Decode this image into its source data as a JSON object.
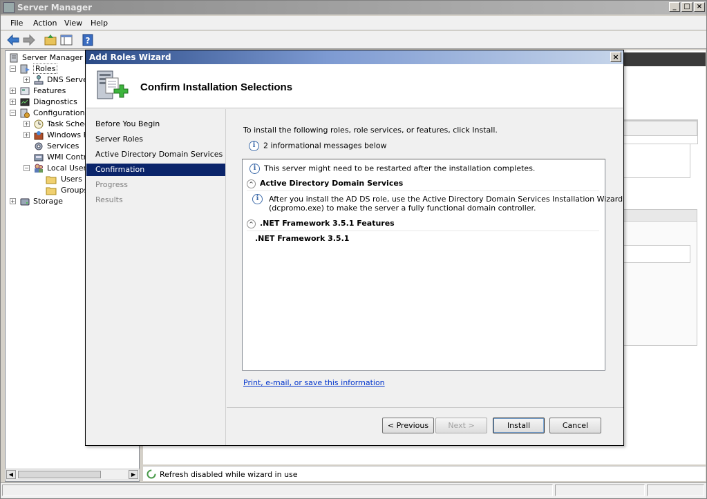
{
  "window": {
    "title": "Server Manager",
    "controls": {
      "minimize": "_",
      "maximize": "□",
      "close": "×"
    }
  },
  "menu": [
    "File",
    "Action",
    "View",
    "Help"
  ],
  "tree": {
    "root": "Server Manager (U",
    "items": [
      {
        "label": "Roles",
        "expand": "−"
      },
      {
        "label": "DNS Server",
        "expand": "+"
      },
      {
        "label": "Features",
        "expand": "+"
      },
      {
        "label": "Diagnostics",
        "expand": "+"
      },
      {
        "label": "Configuration",
        "expand": "−"
      },
      {
        "label": "Task Sched",
        "expand": "+"
      },
      {
        "label": "Windows Fi",
        "expand": "+"
      },
      {
        "label": "Services",
        "expand": ""
      },
      {
        "label": "WMI Contro",
        "expand": ""
      },
      {
        "label": "Local Users",
        "expand": "−"
      },
      {
        "label": "Users",
        "expand": ""
      },
      {
        "label": "Groups",
        "expand": ""
      },
      {
        "label": "Storage",
        "expand": "+"
      }
    ]
  },
  "status_strip": {
    "text": "Refresh disabled while wizard in use"
  },
  "dialog": {
    "title": "Add Roles Wizard",
    "close": "×",
    "heading": "Confirm Installation Selections",
    "steps": [
      {
        "label": "Before You Begin",
        "state": "normal"
      },
      {
        "label": "Server Roles",
        "state": "normal"
      },
      {
        "label": "Active Directory Domain Services",
        "state": "normal"
      },
      {
        "label": "Confirmation",
        "state": "active"
      },
      {
        "label": "Progress",
        "state": "disabled"
      },
      {
        "label": "Results",
        "state": "disabled"
      }
    ],
    "intro": "To install the following roles, role services, or features, click Install.",
    "info_count": "2 informational messages below",
    "list": {
      "restart_note": "This server might need to be restarted after the installation completes.",
      "section1": {
        "title": "Active Directory Domain Services",
        "note_line1": "After you install the AD DS role, use the Active Directory Domain Services Installation Wizard",
        "note_line2": "(dcpromo.exe) to make the server a fully functional domain controller."
      },
      "section2": {
        "title": ".NET Framework 3.5.1 Features",
        "item": ".NET Framework 3.5.1"
      }
    },
    "link": "Print, e-mail, or save this information",
    "buttons": {
      "previous": "< Previous",
      "next": "Next >",
      "install": "Install",
      "cancel": "Cancel"
    },
    "info_glyph": "i",
    "collapse_glyph": "^"
  },
  "colors": {
    "selection": "#0a246a",
    "link": "#0033cc",
    "title_gradient_start": "#2a4a86"
  }
}
